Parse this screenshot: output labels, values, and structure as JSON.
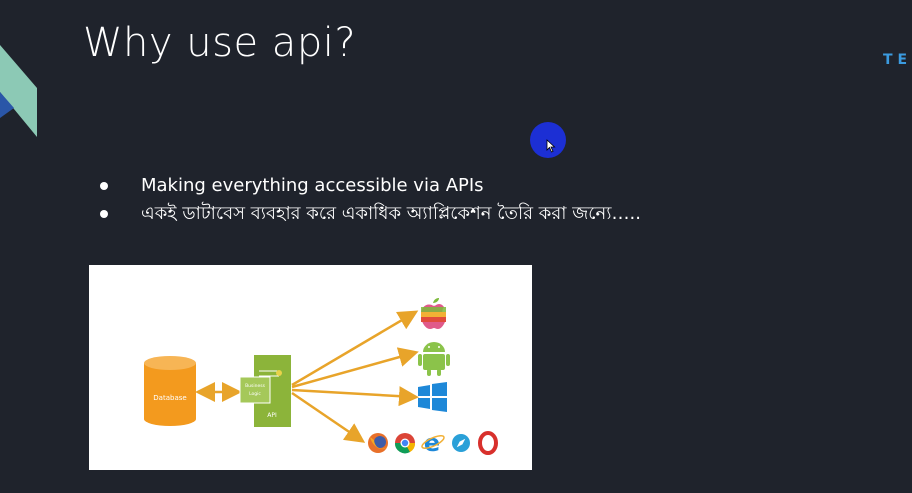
{
  "slide": {
    "title": "Why use api?",
    "brand_text": "TEC"
  },
  "bullets": [
    "Making everything accessible via APIs",
    "একই ডাটাবেস ব্যবহার করে একাধিক অ্যাপ্লিকেশন তৈরি করা জন্যে….."
  ],
  "diagram": {
    "database_label": "Database",
    "business_logic_label_line1": "Business",
    "business_logic_label_line2": "Logic",
    "api_label": "API",
    "targets": [
      "apple-icon",
      "android-icon",
      "windows-icon",
      "firefox-icon",
      "chrome-icon",
      "ie-icon",
      "safari-icon",
      "opera-icon"
    ]
  },
  "colors": {
    "background": "#1f232c",
    "accent_blue": "#3b9be0",
    "arrow_orange": "#e8a42a",
    "database_orange": "#f39a1e",
    "api_green": "#8cb43a",
    "cursor_ring": "#1c2fd4"
  }
}
